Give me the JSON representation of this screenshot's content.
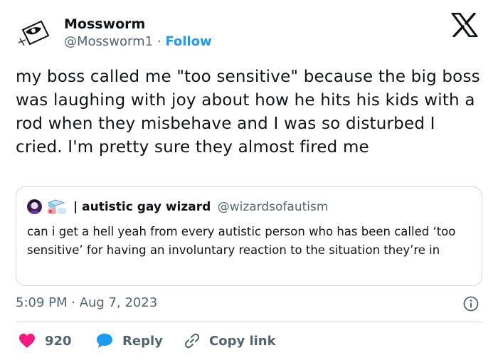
{
  "author": {
    "name": "Mossworm",
    "handle": "@Mossworm1",
    "separator": "·",
    "follow_label": "Follow",
    "avatar_icon": "eye-flag-drawing-icon"
  },
  "brand_icon": "x-logo-icon",
  "tweet": {
    "text": "my boss called me \"too sensitive\" because the big boss was laughing with joy about how he hits his kids with a rod when they misbehave and I was so disturbed I cried. I'm pretty sure they almost fired me",
    "timestamp": "5:09 PM · Aug 7, 2023"
  },
  "quoted_tweet": {
    "name": "| autistic gay wizard",
    "handle": "@wizardsofautism",
    "text": "can i get a hell yeah from every autistic person who has been called ‘too sensitive’ for having an involuntary reaction to the situation they’re in"
  },
  "actions": {
    "likes_count": "920",
    "reply_label": "Reply",
    "copy_link_label": "Copy link"
  },
  "colors": {
    "accent": "#1d9bf0",
    "like": "#f91880",
    "text": "#0f1419",
    "muted": "#536471",
    "border": "#cfd9de"
  }
}
